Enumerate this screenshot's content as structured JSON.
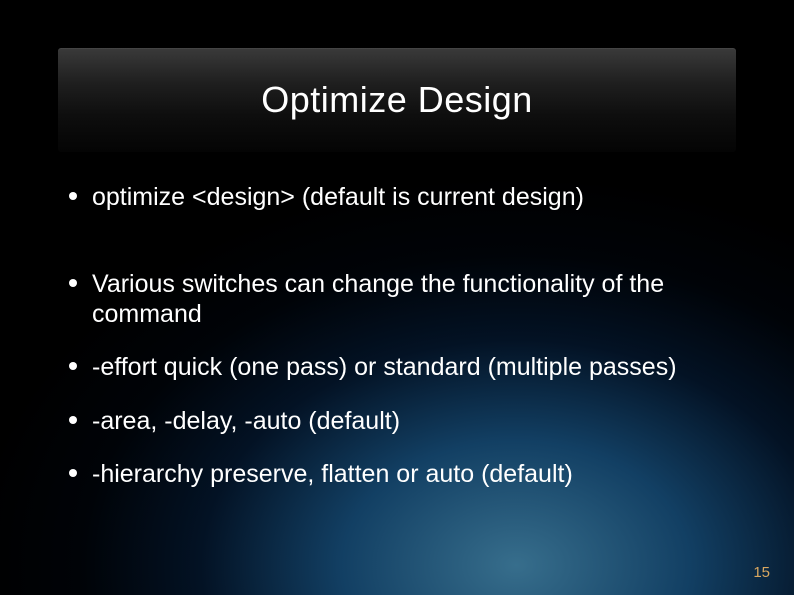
{
  "slide": {
    "title": "Optimize Design",
    "bullets": [
      "optimize <design> (default is current design)",
      "Various switches can change the functionality of the command",
      "-effort quick (one pass) or standard (multiple passes)",
      "-area, -delay, -auto (default)",
      "-hierarchy preserve, flatten or auto (default)"
    ],
    "page_number": "15"
  }
}
